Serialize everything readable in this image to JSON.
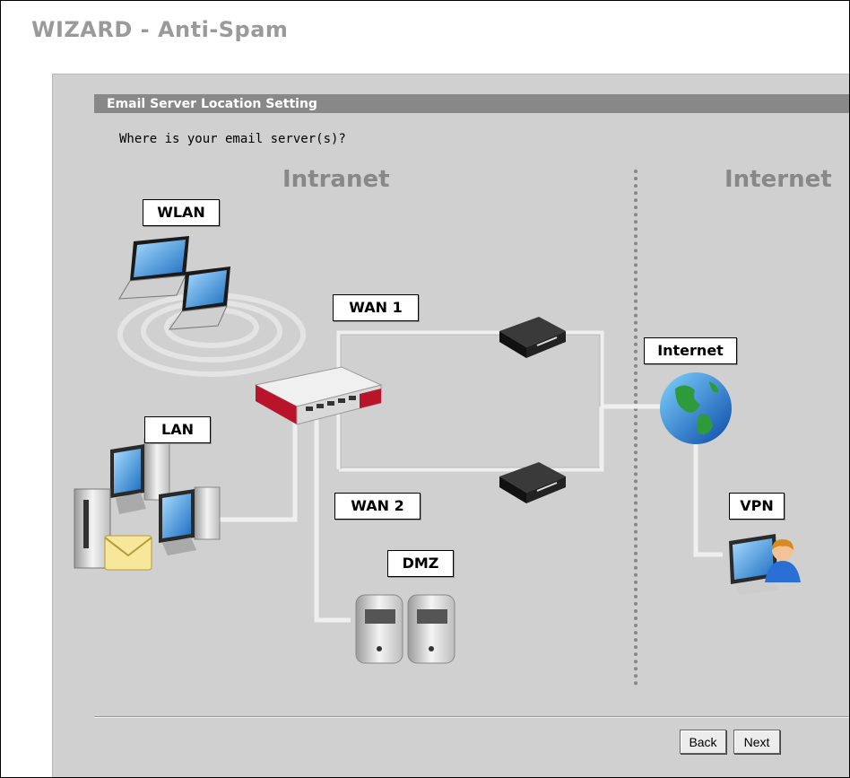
{
  "wizard": {
    "title": "WIZARD - Anti-Spam"
  },
  "section": {
    "title": "Email Server Location Setting"
  },
  "prompt": {
    "question": "Where is your email server(s)?"
  },
  "zones": {
    "intranet": "Intranet",
    "internet": "Internet"
  },
  "labels": {
    "wlan": "WLAN",
    "lan": "LAN",
    "wan1": "WAN 1",
    "wan2": "WAN 2",
    "dmz": "DMZ",
    "internet": "Internet",
    "vpn": "VPN"
  },
  "buttons": {
    "back": "Back",
    "next": "Next"
  },
  "colors": {
    "panel": "#d0d0d0",
    "section_bar": "#888888",
    "zone_text": "#888888",
    "title_text": "#9a9a9a"
  }
}
